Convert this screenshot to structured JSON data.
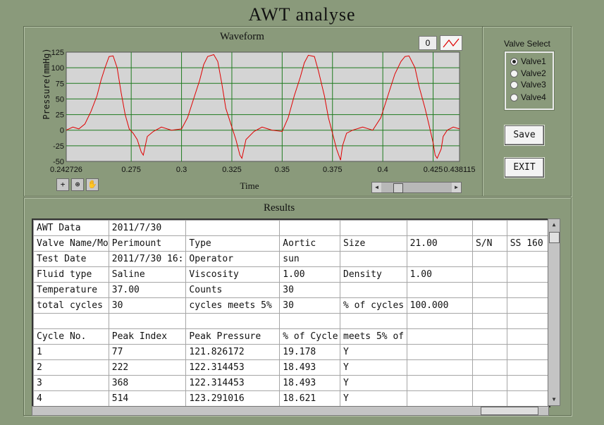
{
  "app": {
    "title": "AWT analyse"
  },
  "waveform": {
    "title": "Waveform",
    "legend_count": "0",
    "toolbar_icons": [
      "crosshair-icon",
      "zoom-icon",
      "pan-hand-icon"
    ]
  },
  "chart_data": {
    "type": "line",
    "title": "Waveform",
    "xlabel": "Time",
    "ylabel": "Pressure(mmHg)",
    "xlim": [
      0.242726,
      0.438115
    ],
    "ylim": [
      -50,
      125
    ],
    "xtick_labels": [
      "0.242726",
      "0.275",
      "0.3",
      "0.325",
      "0.35",
      "0.375",
      "0.4",
      "0.425",
      "0.438115"
    ],
    "ytick_labels": [
      "125",
      "100",
      "75",
      "50",
      "25",
      "0",
      "-25",
      "-50"
    ],
    "grid": true,
    "series": [
      {
        "color": "#e00000",
        "x": [
          0.2427,
          0.246,
          0.249,
          0.252,
          0.255,
          0.258,
          0.26,
          0.262,
          0.264,
          0.266,
          0.268,
          0.27,
          0.272,
          0.274,
          0.276,
          0.278,
          0.28,
          0.281,
          0.283,
          0.286,
          0.29,
          0.295,
          0.3,
          0.303,
          0.306,
          0.309,
          0.311,
          0.313,
          0.316,
          0.318,
          0.32,
          0.322,
          0.325,
          0.327,
          0.329,
          0.33,
          0.332,
          0.336,
          0.34,
          0.345,
          0.35,
          0.353,
          0.356,
          0.359,
          0.361,
          0.363,
          0.366,
          0.368,
          0.371,
          0.373,
          0.375,
          0.377,
          0.379,
          0.38,
          0.382,
          0.385,
          0.39,
          0.395,
          0.399,
          0.403,
          0.406,
          0.409,
          0.411,
          0.413,
          0.416,
          0.418,
          0.421,
          0.423,
          0.425,
          0.426,
          0.427,
          0.429,
          0.43,
          0.432,
          0.435,
          0.4381
        ],
        "y": [
          0,
          5,
          2,
          10,
          30,
          55,
          80,
          100,
          118,
          119,
          100,
          60,
          25,
          2,
          -5,
          -15,
          -35,
          -40,
          -10,
          -2,
          5,
          0,
          2,
          20,
          50,
          80,
          105,
          118,
          121,
          110,
          75,
          35,
          5,
          -15,
          -40,
          -45,
          -15,
          -2,
          5,
          0,
          -2,
          20,
          55,
          85,
          108,
          120,
          118,
          95,
          55,
          20,
          -5,
          -30,
          -48,
          -25,
          -5,
          0,
          5,
          0,
          20,
          60,
          90,
          110,
          118,
          119,
          100,
          70,
          35,
          8,
          -20,
          -40,
          -45,
          -30,
          -10,
          0,
          5,
          2
        ]
      }
    ]
  },
  "valve_select": {
    "label": "Valve Select",
    "options": [
      "Valve1",
      "Valve2",
      "Valve3",
      "Valve4"
    ],
    "selected_index": 0
  },
  "buttons": {
    "save_label": "Save",
    "exit_label": "EXIT"
  },
  "results": {
    "title": "Results",
    "rows": [
      [
        "AWT Data",
        "2011/7/30",
        "",
        "",
        "",
        "",
        "",
        ""
      ],
      [
        "Valve Name/Mo",
        "Perimount",
        "Type",
        "Aortic",
        "Size",
        "21.00",
        "S/N",
        "SS 160"
      ],
      [
        "Test Date",
        "2011/7/30 16:",
        "Operator",
        "sun",
        "",
        "",
        "",
        ""
      ],
      [
        "Fluid type",
        "Saline",
        "Viscosity",
        "1.00",
        "Density",
        "1.00",
        "",
        ""
      ],
      [
        "Temperature",
        "37.00",
        "Counts",
        "30",
        "",
        "",
        "",
        ""
      ],
      [
        "total cycles",
        "30",
        "cycles meets 5%",
        "30",
        "% of cycles",
        "100.000",
        "",
        ""
      ],
      [
        "",
        "",
        "",
        "",
        "",
        "",
        "",
        ""
      ],
      [
        "Cycle No.",
        "Peak Index",
        "Peak Pressure",
        "% of Cycle",
        "meets 5% of",
        "",
        "",
        ""
      ],
      [
        "1",
        "77",
        "121.826172",
        "19.178",
        "Y",
        "",
        "",
        ""
      ],
      [
        "2",
        "222",
        "122.314453",
        "18.493",
        "Y",
        "",
        "",
        ""
      ],
      [
        "3",
        "368",
        "122.314453",
        "18.493",
        "Y",
        "",
        "",
        ""
      ],
      [
        "4",
        "514",
        "123.291016",
        "18.621",
        "Y",
        "",
        "",
        ""
      ]
    ]
  }
}
